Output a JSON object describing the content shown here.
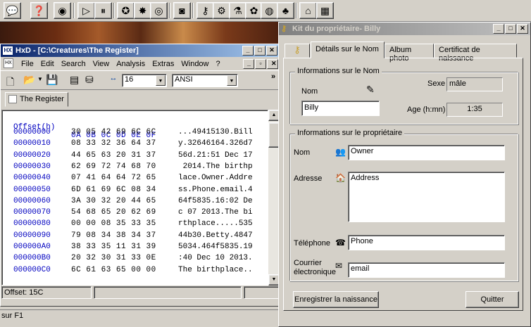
{
  "toolbar": {
    "icons": [
      "speech-bubble-icon",
      "question-icon",
      "globe-web-icon",
      "play-icon",
      "pause-icon",
      "tools-icon",
      "help-tools-icon",
      "eye-icon",
      "camera-icon",
      "key-icon",
      "cog-icon",
      "flask-icon",
      "agents-icon",
      "earth-icon",
      "molecule-icon",
      "house-icon",
      "blank-icon"
    ]
  },
  "hxd": {
    "title": "HxD - [C:\\Creatures\\The Register]",
    "menu": [
      "File",
      "Edit",
      "Search",
      "View",
      "Analysis",
      "Extras",
      "Window",
      "?"
    ],
    "bytes_per_row": "16",
    "charset": "ANSI",
    "tab_label": "The Register",
    "header": {
      "offset": "Offset(h)",
      "cols": "0A 0B 0C 0D 0E 0F"
    },
    "rows": [
      {
        "offset": "00000000",
        "bytes": "30 05 42 69 6C 6C",
        "ascii": "...49415130.Bill"
      },
      {
        "offset": "00000010",
        "bytes": "08 33 32 36 64 37",
        "ascii": "y.32646164.326d7"
      },
      {
        "offset": "00000020",
        "bytes": "44 65 63 20 31 37",
        "ascii": "56d.21:51 Dec 17"
      },
      {
        "offset": "00000030",
        "bytes": "62 69 72 74 68 70",
        "ascii": " 2014.The birthp"
      },
      {
        "offset": "00000040",
        "bytes": "07 41 64 64 72 65",
        "ascii": "lace.Owner.Addre"
      },
      {
        "offset": "00000050",
        "bytes": "6D 61 69 6C 08 34",
        "ascii": "ss.Phone.email.4"
      },
      {
        "offset": "00000060",
        "bytes": "3A 30 32 20 44 65",
        "ascii": "64f5835.16:02 De"
      },
      {
        "offset": "00000070",
        "bytes": "54 68 65 20 62 69",
        "ascii": "c 07 2013.The bi"
      },
      {
        "offset": "00000080",
        "bytes": "00 00 08 35 33 35",
        "ascii": "rthplace.....535"
      },
      {
        "offset": "00000090",
        "bytes": "79 08 34 38 34 37",
        "ascii": "44b30.Betty.4847"
      },
      {
        "offset": "000000A0",
        "bytes": "38 33 35 11 31 39",
        "ascii": "5034.464f5835.19"
      },
      {
        "offset": "000000B0",
        "bytes": "20 32 30 31 33 0E",
        "ascii": ":40 Dec 10 2013."
      },
      {
        "offset": "000000C0",
        "bytes": "6C 61 63 65 00 00",
        "ascii": "The birthplace.."
      }
    ],
    "status_offset": "Offset: 15C"
  },
  "statusbar": {
    "text": "sur F1"
  },
  "kit": {
    "title": "Kit du propriétaire- Billy",
    "tabs": [
      "Détails sur le Nom",
      "Album photo",
      "Certificat de naissance"
    ],
    "name_group": {
      "label": "Informations sur le Nom",
      "name_label": "Nom",
      "name_value": "Billy",
      "sex_label": "Sexe",
      "sex_value": "mâle",
      "age_label": "Age (h:mn)",
      "age_value": "1:35"
    },
    "owner_group": {
      "label": "Informations sur le propriétaire",
      "name_label": "Nom",
      "name_value": "Owner",
      "address_label": "Adresse",
      "address_value": "Address",
      "phone_label": "Téléphone",
      "phone_value": "Phone",
      "email_label_1": "Courrier",
      "email_label_2": "électronique",
      "email_value": "email"
    },
    "register_button": "Enregistrer la naissance",
    "quit_button": "Quitter"
  }
}
